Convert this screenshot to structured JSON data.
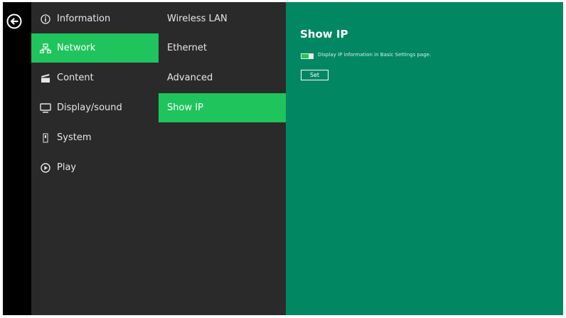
{
  "nav": {
    "back_icon": "back-arrow-icon",
    "main_menu": [
      {
        "label": "Information",
        "icon": "info-icon",
        "active": false
      },
      {
        "label": "Network",
        "icon": "network-icon",
        "active": true
      },
      {
        "label": "Content",
        "icon": "content-icon",
        "active": false
      },
      {
        "label": "Display/sound",
        "icon": "display-icon",
        "active": false
      },
      {
        "label": "System",
        "icon": "system-icon",
        "active": false
      },
      {
        "label": "Play",
        "icon": "play-icon",
        "active": false
      }
    ],
    "sub_menu": [
      {
        "label": "Wireless LAN",
        "active": false
      },
      {
        "label": "Ethernet",
        "active": false
      },
      {
        "label": "Advanced",
        "active": false
      },
      {
        "label": "Show IP",
        "active": true
      }
    ]
  },
  "panel": {
    "title": "Show IP",
    "toggle_label": "Display IP information in Basic Settings page.",
    "toggle_on": true,
    "set_label": "Set"
  },
  "colors": {
    "accent": "#1fc45c",
    "panel_bg": "#018762",
    "menu_bg": "#2a2a2a",
    "frame_bg": "#000000"
  }
}
